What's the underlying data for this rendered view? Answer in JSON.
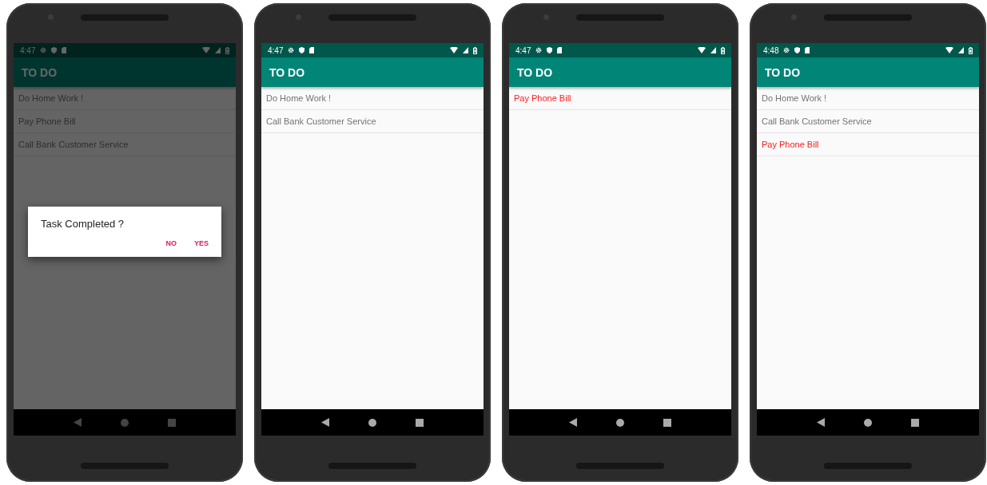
{
  "phones": [
    {
      "status_time": "4:47",
      "title": "TO DO",
      "items": [
        {
          "label": "Do Home Work !",
          "highlighted": false
        },
        {
          "label": "Pay Phone Bill",
          "highlighted": false
        },
        {
          "label": "Call Bank Customer Service",
          "highlighted": false
        }
      ],
      "dialog": {
        "title": "Task Completed ?",
        "buttons": [
          "NO",
          "YES"
        ]
      }
    },
    {
      "status_time": "4:47",
      "title": "TO DO",
      "items": [
        {
          "label": "Do Home Work !",
          "highlighted": false
        },
        {
          "label": "Call Bank Customer Service",
          "highlighted": false
        }
      ]
    },
    {
      "status_time": "4:47",
      "title": "TO DO",
      "items": [
        {
          "label": "Pay Phone Bill",
          "highlighted": true
        }
      ]
    },
    {
      "status_time": "4:48",
      "title": "TO DO",
      "items": [
        {
          "label": "Do Home Work !",
          "highlighted": false
        },
        {
          "label": "Call Bank Customer Service",
          "highlighted": false
        },
        {
          "label": "Pay Phone Bill",
          "highlighted": true
        }
      ]
    }
  ]
}
